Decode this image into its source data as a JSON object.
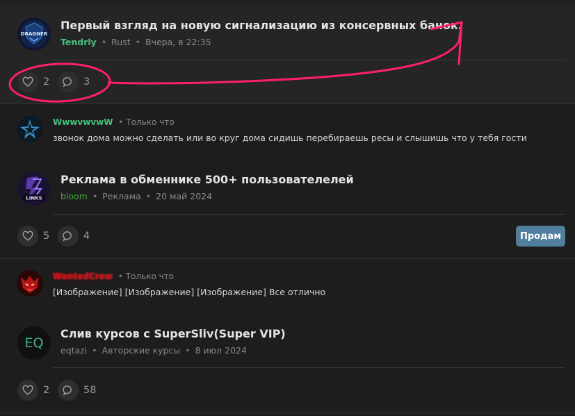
{
  "threads": [
    {
      "title": "Первый взгляд на новую сигнализацию из консервных банок.",
      "author": "Tendrly",
      "category": "Rust",
      "date": "Вчера, в 22:35",
      "likes": "2",
      "comments": "3",
      "avatar_text": "DRAGNER",
      "last_reply": {
        "username": "WwwvwvwW",
        "time": "Только что",
        "text": "звонок дома можно сделать или во круг дома сидишь перебираешь ресы и слышишь что у тебя гости"
      }
    },
    {
      "title": "Реклама в обменнике 500+ пользователелей",
      "author": "bloom",
      "category": "Реклама",
      "date": "20 май 2024",
      "likes": "5",
      "comments": "4",
      "button_label": "Продам",
      "avatar_text": "LINKS",
      "last_reply": {
        "username": "WantedCrew",
        "time": "Только что",
        "text": "[Изображение] [Изображение] [Изображение] Все отлично"
      }
    },
    {
      "title": "Слив курсов с SuperSliv(Super VIP)",
      "author": "eqtazi",
      "category": "Авторские курсы",
      "date": "8 июл 2024",
      "likes": "2",
      "comments": "58",
      "avatar_text": "EQ"
    }
  ],
  "colors": {
    "annotation": "#ff1f6e",
    "accent_button": "#4f7f9c",
    "author_green": "#46c27a",
    "wanted_red": "#c0131a"
  },
  "icons": [
    "heart-icon",
    "comment-bubble-icon"
  ]
}
